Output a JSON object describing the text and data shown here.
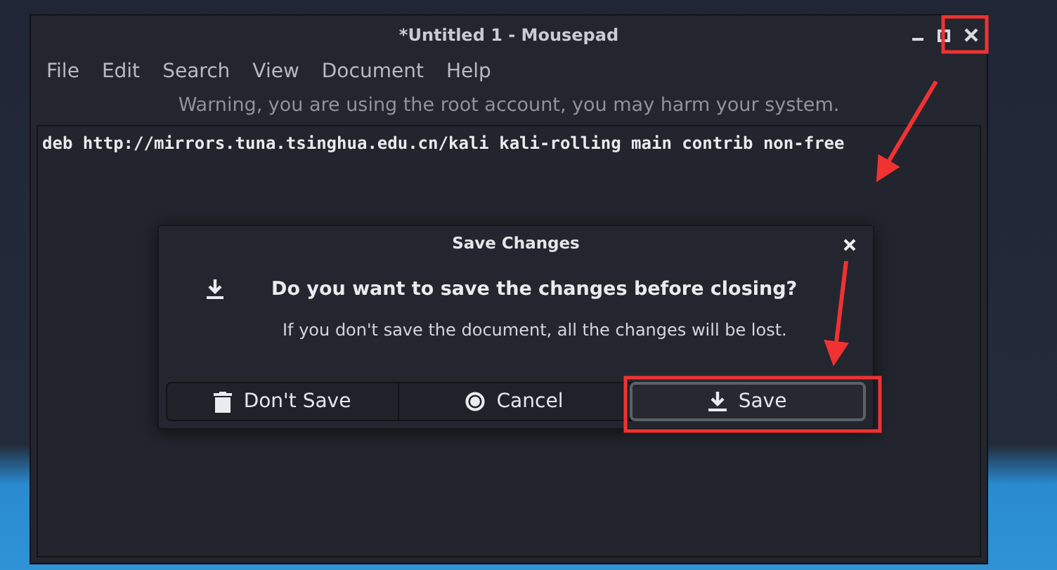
{
  "window": {
    "title": "*Untitled 1 - Mousepad"
  },
  "menu": [
    "File",
    "Edit",
    "Search",
    "View",
    "Document",
    "Help"
  ],
  "warning": "Warning, you are using the root account, you may harm your system.",
  "editor": {
    "lines": [
      "deb http://mirrors.tuna.tsinghua.edu.cn/kali kali-rolling main contrib non-free"
    ]
  },
  "dialog": {
    "title": "Save Changes",
    "heading": "Do you want to save the changes before closing?",
    "message": "If you don't save the document, all the changes will be lost.",
    "buttons": [
      {
        "label": "Don't Save",
        "kind": "discard",
        "focused": false
      },
      {
        "label": "Cancel",
        "kind": "cancel",
        "focused": false
      },
      {
        "label": "Save",
        "kind": "save",
        "focused": true
      }
    ]
  }
}
